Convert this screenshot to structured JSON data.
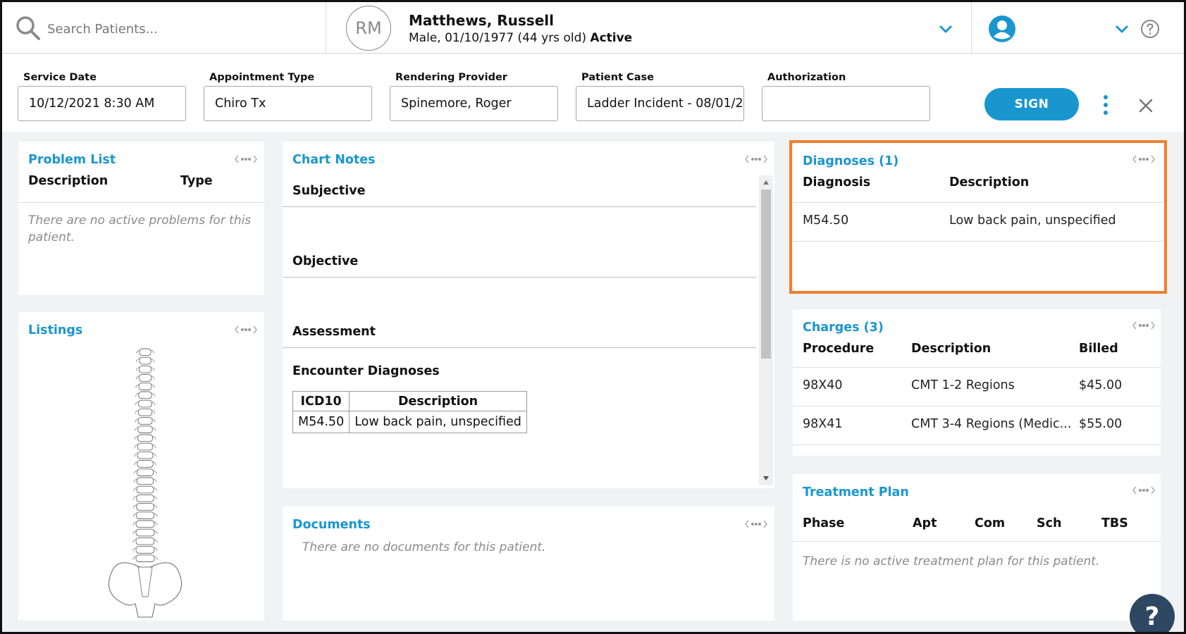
{
  "search": {
    "placeholder": "Search Patients..."
  },
  "patient": {
    "initials": "RM",
    "name": "Matthews, Russell",
    "info": "Male, 01/10/1977 (44 yrs old)",
    "status": "Active"
  },
  "filters": {
    "service_date": {
      "label": "Service Date",
      "value": "10/12/2021 8:30 AM"
    },
    "appointment_type": {
      "label": "Appointment Type",
      "value": "Chiro Tx"
    },
    "rendering_provider": {
      "label": "Rendering Provider",
      "value": "Spinemore, Roger"
    },
    "patient_case": {
      "label": "Patient Case",
      "value": "Ladder Incident - 08/01/2"
    },
    "authorization": {
      "label": "Authorization",
      "value": ""
    }
  },
  "actions": {
    "sign_label": "SIGN"
  },
  "problem_list": {
    "title": "Problem List",
    "columns": [
      "Description",
      "Type"
    ],
    "empty": "There are no active problems for this patient."
  },
  "listings": {
    "title": "Listings",
    "diagram": "spine-diagram"
  },
  "chart_notes": {
    "title": "Chart Notes",
    "sections": [
      "Subjective",
      "Objective",
      "Assessment"
    ],
    "encounter_title": "Encounter Diagnoses",
    "encounter_columns": [
      "ICD10",
      "Description"
    ],
    "encounter_rows": [
      {
        "code": "M54.50",
        "description": "Low back pain, unspecified"
      }
    ]
  },
  "documents": {
    "title": "Documents",
    "empty": "There are no documents for this patient."
  },
  "diagnoses": {
    "title": "Diagnoses (1)",
    "columns": [
      "Diagnosis",
      "Description"
    ],
    "rows": [
      {
        "code": "M54.50",
        "description": "Low back pain, unspecified"
      }
    ]
  },
  "charges": {
    "title": "Charges (3)",
    "columns": [
      "Procedure",
      "Description",
      "Billed"
    ],
    "rows": [
      {
        "procedure": "98X40",
        "description": "CMT 1-2 Regions",
        "billed": "$45.00"
      },
      {
        "procedure": "98X41",
        "description": "CMT 3-4 Regions (Medic...",
        "billed": "$55.00"
      }
    ]
  },
  "treatment_plan": {
    "title": "Treatment Plan",
    "columns": [
      "Phase",
      "Apt",
      "Com",
      "Sch",
      "TBS"
    ],
    "empty": "There is no active treatment plan for this patient."
  },
  "help": {
    "label": "?"
  },
  "colors": {
    "accent": "#1a96cf",
    "highlight": "#f07f2e",
    "fab": "#2e4762"
  },
  "icons": [
    "search-icon",
    "chevron-down-icon",
    "user-icon",
    "help-circle-icon",
    "more-vertical-icon",
    "close-icon",
    "panel-menu-icon",
    "sort-up-icon",
    "sort-down-icon"
  ]
}
